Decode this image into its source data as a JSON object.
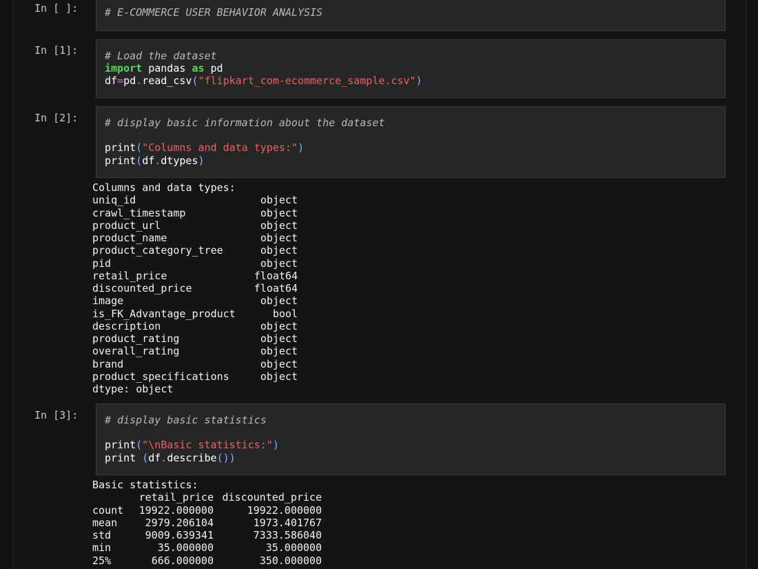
{
  "cells": [
    {
      "prompt": "In [ ]:",
      "lines": [
        [
          {
            "t": "comment",
            "v": "# E-COMMERCE USER BEHAVIOR ANALYSIS"
          }
        ]
      ]
    },
    {
      "prompt": "In [1]:",
      "lines": [
        [
          {
            "t": "comment",
            "v": "# Load the dataset"
          }
        ],
        [
          {
            "t": "kw",
            "v": "import"
          },
          {
            "t": "plain",
            "v": " pandas "
          },
          {
            "t": "kw",
            "v": "as"
          },
          {
            "t": "plain",
            "v": " pd"
          }
        ],
        [
          {
            "t": "plain",
            "v": "df"
          },
          {
            "t": "op",
            "v": "="
          },
          {
            "t": "plain",
            "v": "pd"
          },
          {
            "t": "op",
            "v": "."
          },
          {
            "t": "plain",
            "v": "read_csv"
          },
          {
            "t": "paren",
            "v": "("
          },
          {
            "t": "str",
            "v": "\"flipkart_com-ecommerce_sample.csv\""
          },
          {
            "t": "paren",
            "v": ")"
          }
        ]
      ]
    },
    {
      "prompt": "In [2]:",
      "lines": [
        [
          {
            "t": "comment",
            "v": "# display basic information about the dataset"
          }
        ],
        [
          {
            "t": "plain",
            "v": ""
          }
        ],
        [
          {
            "t": "plain",
            "v": "print"
          },
          {
            "t": "paren",
            "v": "("
          },
          {
            "t": "str",
            "v": "\"Columns and data types:\""
          },
          {
            "t": "paren",
            "v": ")"
          }
        ],
        [
          {
            "t": "plain",
            "v": "print"
          },
          {
            "t": "paren",
            "v": "("
          },
          {
            "t": "plain",
            "v": "df"
          },
          {
            "t": "op",
            "v": "."
          },
          {
            "t": "plain",
            "v": "dtypes"
          },
          {
            "t": "paren",
            "v": ")"
          }
        ]
      ]
    },
    {
      "prompt": "In [3]:",
      "lines": [
        [
          {
            "t": "comment",
            "v": "# display basic statistics"
          }
        ],
        [
          {
            "t": "plain",
            "v": ""
          }
        ],
        [
          {
            "t": "plain",
            "v": "print"
          },
          {
            "t": "paren",
            "v": "("
          },
          {
            "t": "str",
            "v": "\"\\nBasic statistics:\""
          },
          {
            "t": "paren",
            "v": ")"
          }
        ],
        [
          {
            "t": "plain",
            "v": "print "
          },
          {
            "t": "paren",
            "v": "("
          },
          {
            "t": "plain",
            "v": "df"
          },
          {
            "t": "op",
            "v": "."
          },
          {
            "t": "plain",
            "v": "describe"
          },
          {
            "t": "paren",
            "v": "())"
          }
        ]
      ]
    }
  ],
  "output_dtypes": {
    "header": "Columns and data types:",
    "rows": [
      {
        "name": "uniq_id",
        "type": "object"
      },
      {
        "name": "crawl_timestamp",
        "type": "object"
      },
      {
        "name": "product_url",
        "type": "object"
      },
      {
        "name": "product_name",
        "type": "object"
      },
      {
        "name": "product_category_tree",
        "type": "object"
      },
      {
        "name": "pid",
        "type": "object"
      },
      {
        "name": "retail_price",
        "type": "float64"
      },
      {
        "name": "discounted_price",
        "type": "float64"
      },
      {
        "name": "image",
        "type": "object"
      },
      {
        "name": "is_FK_Advantage_product",
        "type": "bool"
      },
      {
        "name": "description",
        "type": "object"
      },
      {
        "name": "product_rating",
        "type": "object"
      },
      {
        "name": "overall_rating",
        "type": "object"
      },
      {
        "name": "brand",
        "type": "object"
      },
      {
        "name": "product_specifications",
        "type": "object"
      }
    ],
    "footer": "dtype: object"
  },
  "output_stats": {
    "header": "Basic statistics:",
    "columns": [
      "retail_price",
      "discounted_price"
    ],
    "rows": [
      {
        "idx": "count",
        "c1": "19922.000000",
        "c2": "19922.000000"
      },
      {
        "idx": "mean",
        "c1": "2979.206104",
        "c2": "1973.401767"
      },
      {
        "idx": "std",
        "c1": "9009.639341",
        "c2": "7333.586040"
      },
      {
        "idx": "min",
        "c1": "35.000000",
        "c2": "35.000000"
      },
      {
        "idx": "25%",
        "c1": "666.000000",
        "c2": "350.000000"
      }
    ]
  },
  "colors": {
    "background": "#141414",
    "cell_bg": "#262626",
    "keyword": "#5fd35f",
    "string": "#ef5f5f",
    "comment": "#b8b8b8",
    "paren": "#7fb2ff"
  }
}
